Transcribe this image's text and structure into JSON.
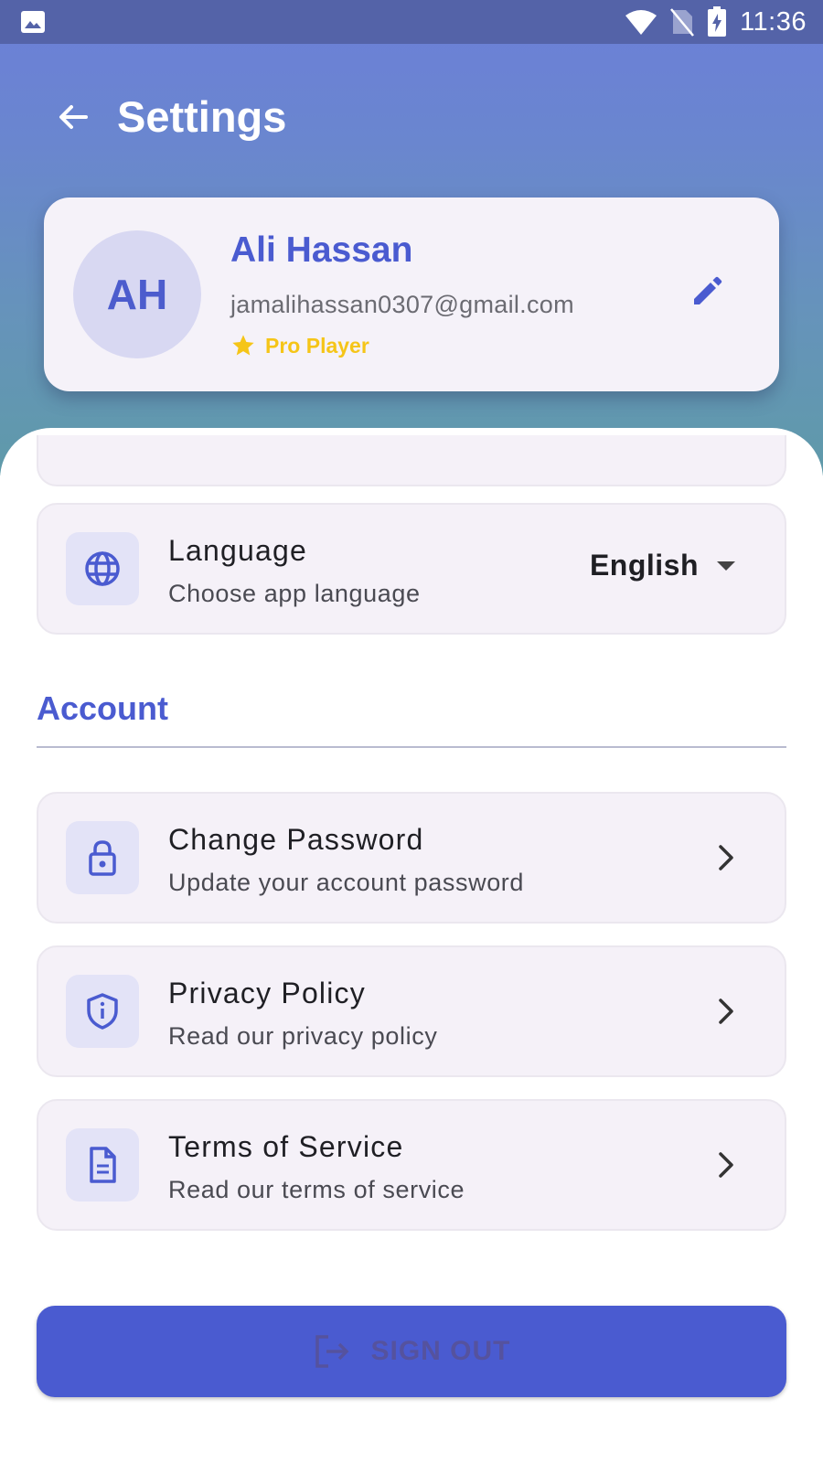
{
  "status_bar": {
    "time": "11:36",
    "icons": [
      "image-icon",
      "wifi-icon",
      "no-sim-icon",
      "battery-charging-icon"
    ]
  },
  "app_bar": {
    "title": "Settings",
    "back_icon": "arrow-back-icon"
  },
  "profile": {
    "initials": "AH",
    "name": "Ali Hassan",
    "email": "jamalihassan0307@gmail.com",
    "badge_icon": "star-icon",
    "badge": "Pro Player",
    "edit_icon": "pencil-icon"
  },
  "preferences": {
    "language": {
      "icon": "globe-icon",
      "title": "Language",
      "subtitle": "Choose app language",
      "selected": "English"
    }
  },
  "account": {
    "section_title": "Account",
    "items": [
      {
        "icon": "lock-icon",
        "title": "Change Password",
        "subtitle": "Update your account password"
      },
      {
        "icon": "shield-info-icon",
        "title": "Privacy Policy",
        "subtitle": "Read our privacy policy"
      },
      {
        "icon": "document-icon",
        "title": "Terms of Service",
        "subtitle": "Read our terms of service"
      }
    ]
  },
  "sign_out": {
    "label": "SIGN OUT",
    "icon": "logout-icon"
  },
  "colors": {
    "primary": "#4a5bd0",
    "badge": "#f5c518",
    "card_bg": "#f5f1f8",
    "status_bar": "#5463a8"
  }
}
